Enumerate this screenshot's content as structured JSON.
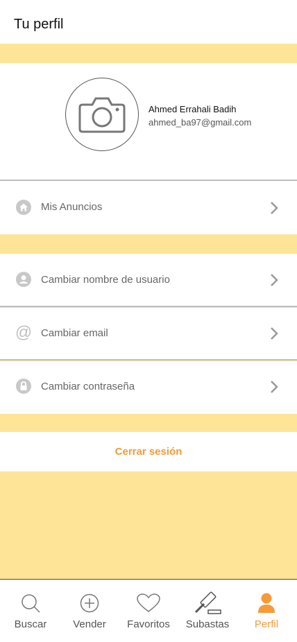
{
  "header": {
    "title": "Tu perfil"
  },
  "profile": {
    "name": "Ahmed Errahali Badih",
    "email": "ahmed_ba97@gmail.com"
  },
  "menu": {
    "ads": {
      "label": "Mis Anuncios",
      "icon": "home-icon"
    },
    "username": {
      "label": "Cambiar nombre de usuario",
      "icon": "user-icon"
    },
    "email": {
      "label": "Cambiar email",
      "icon": "at-icon"
    },
    "password": {
      "label": "Cambiar contraseña",
      "icon": "lock-icon"
    }
  },
  "logout": {
    "label": "Cerrar sesión"
  },
  "tabs": [
    {
      "label": "Buscar",
      "icon": "search-icon"
    },
    {
      "label": "Vender",
      "icon": "plus-circle-icon"
    },
    {
      "label": "Favoritos",
      "icon": "heart-icon"
    },
    {
      "label": "Subastas",
      "icon": "gavel-icon"
    },
    {
      "label": "Perfil",
      "icon": "user-icon",
      "active": true
    }
  ],
  "colors": {
    "accent": "#f79a38",
    "band": "#fee497",
    "divider": "#bdbdbd"
  }
}
